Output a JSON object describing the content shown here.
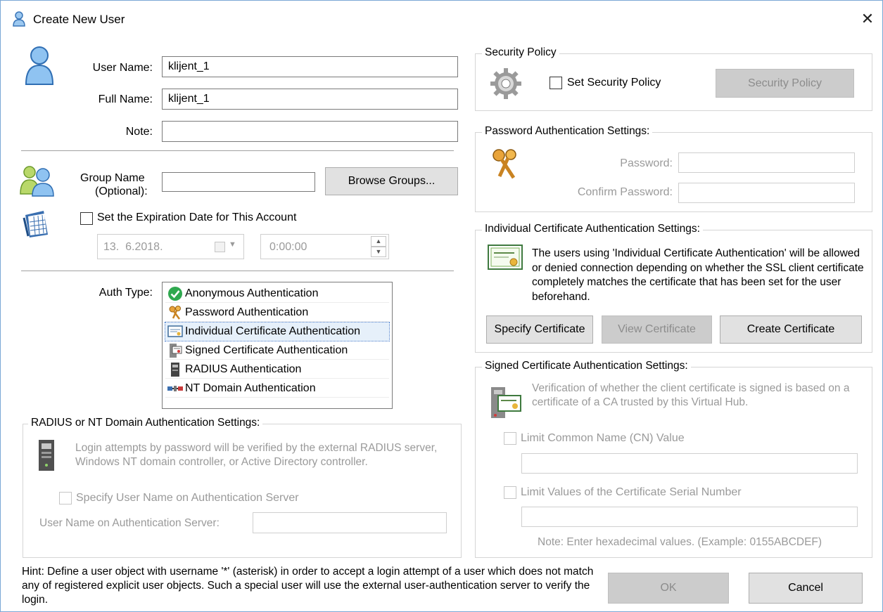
{
  "window": {
    "title": "Create New User",
    "close_glyph": "✕"
  },
  "user": {
    "user_name_label": "User Name:",
    "user_name_value": "klijent_1",
    "full_name_label": "Full Name:",
    "full_name_value": "klijent_1",
    "note_label": "Note:",
    "note_value": ""
  },
  "group": {
    "label_line1": "Group Name",
    "label_line2": "(Optional):",
    "value": "",
    "browse_button": "Browse Groups..."
  },
  "expiration": {
    "checkbox_label": "Set the Expiration Date for This Account",
    "checked": false,
    "date_value": "13.  6.2018.",
    "time_value": "0:00:00"
  },
  "auth": {
    "label": "Auth Type:",
    "selected_index": 2,
    "options": [
      {
        "label": "Anonymous Authentication",
        "icon": "check-circle-icon"
      },
      {
        "label": "Password Authentication",
        "icon": "keys-icon"
      },
      {
        "label": "Individual Certificate Authentication",
        "icon": "certificate-icon"
      },
      {
        "label": "Signed Certificate Authentication",
        "icon": "signed-certificate-icon"
      },
      {
        "label": "RADIUS Authentication",
        "icon": "server-icon"
      },
      {
        "label": "NT Domain Authentication",
        "icon": "network-icon"
      }
    ]
  },
  "radius": {
    "title": "RADIUS or NT Domain Authentication Settings:",
    "description": "Login attempts by password will be verified by the external RADIUS server, Windows NT domain controller, or Active Directory controller.",
    "specify_checkbox": "Specify User Name on Authentication Server",
    "username_label": "User Name on Authentication Server:",
    "username_value": ""
  },
  "security_policy": {
    "title": "Security Policy",
    "checkbox_label": "Set Security Policy",
    "button": "Security Policy"
  },
  "password_auth": {
    "title": "Password Authentication Settings:",
    "password_label": "Password:",
    "confirm_label": "Confirm Password:"
  },
  "individual_cert": {
    "title": "Individual Certificate Authentication Settings:",
    "description": "The users using 'Individual Certificate Authentication' will be allowed or denied connection depending on whether the SSL client certificate completely matches the certificate that has been set for the user beforehand.",
    "specify_button": "Specify Certificate",
    "view_button": "View Certificate",
    "create_button": "Create Certificate"
  },
  "signed_cert": {
    "title": "Signed Certificate Authentication Settings:",
    "description": "Verification of whether the client certificate is signed is based on a certificate of a CA trusted by this Virtual Hub.",
    "limit_cn_label": "Limit Common Name (CN) Value",
    "limit_serial_label": "Limit Values of the Certificate Serial Number",
    "note": "Note: Enter hexadecimal values. (Example: 0155ABCDEF)"
  },
  "footer": {
    "hint": "Hint: Define a user object with username '*' (asterisk) in order to accept a login attempt of a user which does not match any of registered explicit user objects. Such a special user will use the external user-authentication server to verify the login.",
    "ok_button": "OK",
    "cancel_button": "Cancel"
  },
  "colors": {
    "accent": "#0078d7",
    "disabled_text": "#9a9a9a",
    "button_face": "#e1e1e1",
    "group_border": "#d5d5d5"
  }
}
